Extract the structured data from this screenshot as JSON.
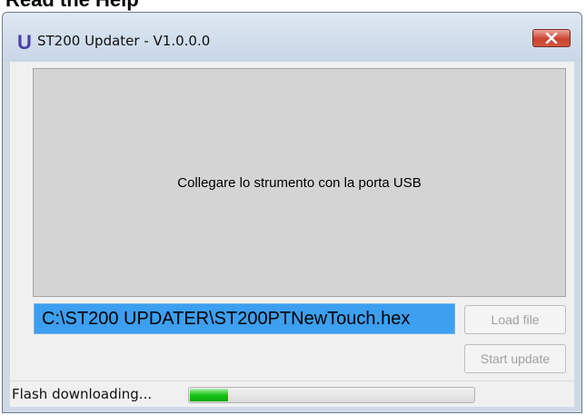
{
  "window": {
    "title": "ST200 Updater - V1.0.0.0",
    "app_icon_glyph": "U",
    "close_icon": "close-icon"
  },
  "main": {
    "message": "Collegare lo strumento con la porta USB",
    "file_path": "C:\\ST200 UPDATER\\ST200PTNewTouch.hex",
    "load_button_label": "Load file",
    "start_button_label": "Start update"
  },
  "status": {
    "label": "Flash downloading...",
    "progress": 0.14
  },
  "colors": {
    "close_button": "#c9432e",
    "file_path_highlight": "#3d9ff0",
    "progress_fill": "#19c419"
  }
}
